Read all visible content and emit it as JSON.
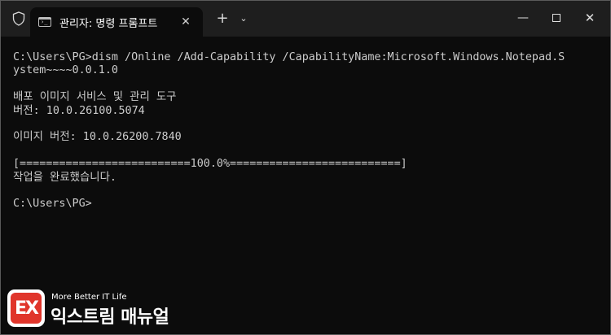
{
  "window": {
    "tab_title": "관리자: 명령 프롬프트",
    "tab_close": "✕",
    "new_tab": "+",
    "tab_dropdown": "⌄",
    "minimize": "—",
    "close": "✕"
  },
  "terminal": {
    "lines": [
      "C:\\Users\\PG>dism /Online /Add-Capability /CapabilityName:Microsoft.Windows.Notepad.S",
      "ystem~~~~0.0.1.0",
      "",
      "배포 이미지 서비스 및 관리 도구",
      "버전: 10.0.26100.5074",
      "",
      "이미지 버전: 10.0.26200.7840",
      "",
      "[==========================100.0%==========================]",
      "작업을 완료했습니다.",
      "",
      "C:\\Users\\PG>"
    ]
  },
  "watermark": {
    "logo_text": "EX",
    "tagline": "More Better IT Life",
    "name": "익스트림 매뉴얼"
  },
  "colors": {
    "terminal_bg": "#0c0c0c",
    "titlebar_bg": "#1e1e1e",
    "terminal_text": "#cccccc",
    "logo_red": "#e0352b"
  }
}
